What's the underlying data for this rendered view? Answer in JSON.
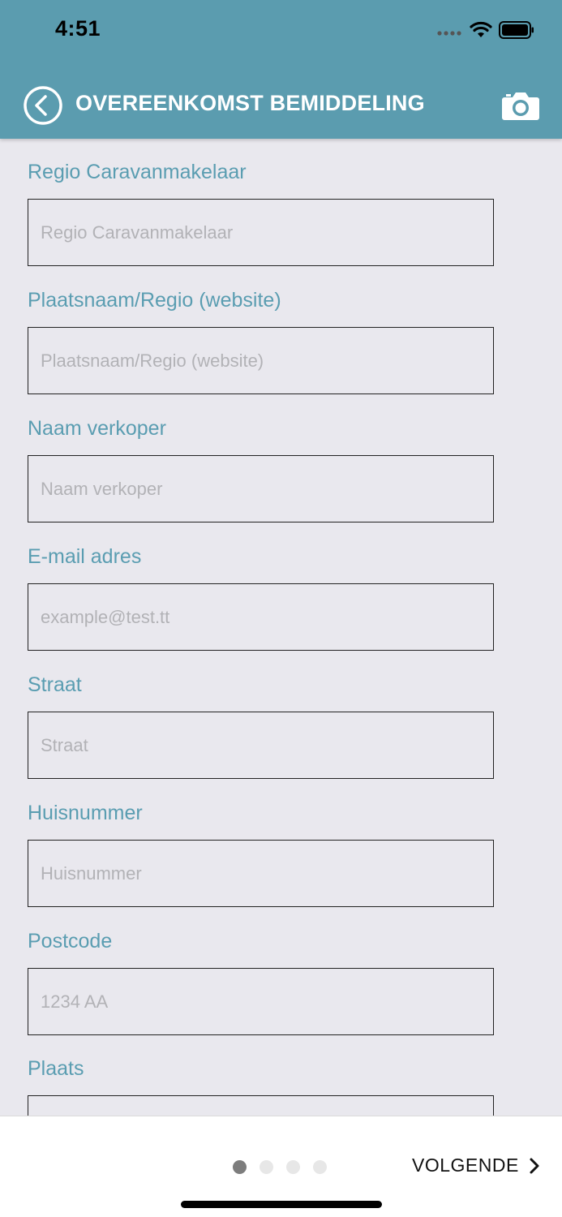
{
  "status_bar": {
    "time": "4:51",
    "icons": [
      "signal-icon",
      "wifi-icon",
      "battery-icon"
    ]
  },
  "header": {
    "title": "OVEREENKOMST BEMIDDELING",
    "icons": [
      "back-icon",
      "camera-icon"
    ],
    "color": "#5b9caf"
  },
  "form": {
    "fields": [
      {
        "label": "Regio Caravanmakelaar",
        "placeholder": "Regio Caravanmakelaar",
        "value": ""
      },
      {
        "label": "Plaatsnaam/Regio (website)",
        "placeholder": "Plaatsnaam/Regio (website)",
        "value": ""
      },
      {
        "label": "Naam verkoper",
        "placeholder": "Naam verkoper",
        "value": ""
      },
      {
        "label": "E-mail adres",
        "placeholder": "example@test.tt",
        "value": ""
      },
      {
        "label": "Straat",
        "placeholder": "Straat",
        "value": ""
      },
      {
        "label": "Huisnummer",
        "placeholder": "Huisnummer",
        "value": ""
      },
      {
        "label": "Postcode",
        "placeholder": "1234 AA",
        "value": ""
      },
      {
        "label": "Plaats",
        "placeholder": "",
        "value": ""
      }
    ],
    "label_color": "#5a9db1"
  },
  "footer": {
    "page_count": 4,
    "current_page": 1,
    "next_label": "VOLGENDE"
  }
}
